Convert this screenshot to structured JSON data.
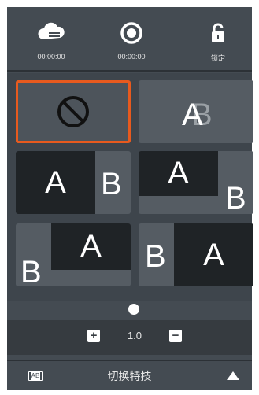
{
  "topbar": {
    "items": [
      {
        "icon": "cloud-sync-icon",
        "label": "00:00:00"
      },
      {
        "icon": "record-icon",
        "label": "00:00:00"
      },
      {
        "icon": "unlock-icon",
        "label": "锁定"
      }
    ]
  },
  "tiles": [
    {
      "name": "none",
      "content": "⊘"
    },
    {
      "name": "overlap-ab",
      "a": "A",
      "b": "B"
    },
    {
      "name": "split-a-left",
      "a": "A",
      "b": "B"
    },
    {
      "name": "a-top-left-b-bottom-right",
      "a": "A",
      "b": "B"
    },
    {
      "name": "b-bottom-left-a-top-right",
      "a": "A",
      "b": "B"
    },
    {
      "name": "split-b-left-a-right",
      "a": "A",
      "b": "B"
    }
  ],
  "zoom": {
    "plus": "+",
    "value": "1.0",
    "minus": "−"
  },
  "bottombar": {
    "icon_text": "AB",
    "title": "切换特技"
  },
  "colors": {
    "accent": "#e85a1e",
    "panel": "#444b52",
    "tile": "#555c63",
    "dark": "#1f2326"
  }
}
